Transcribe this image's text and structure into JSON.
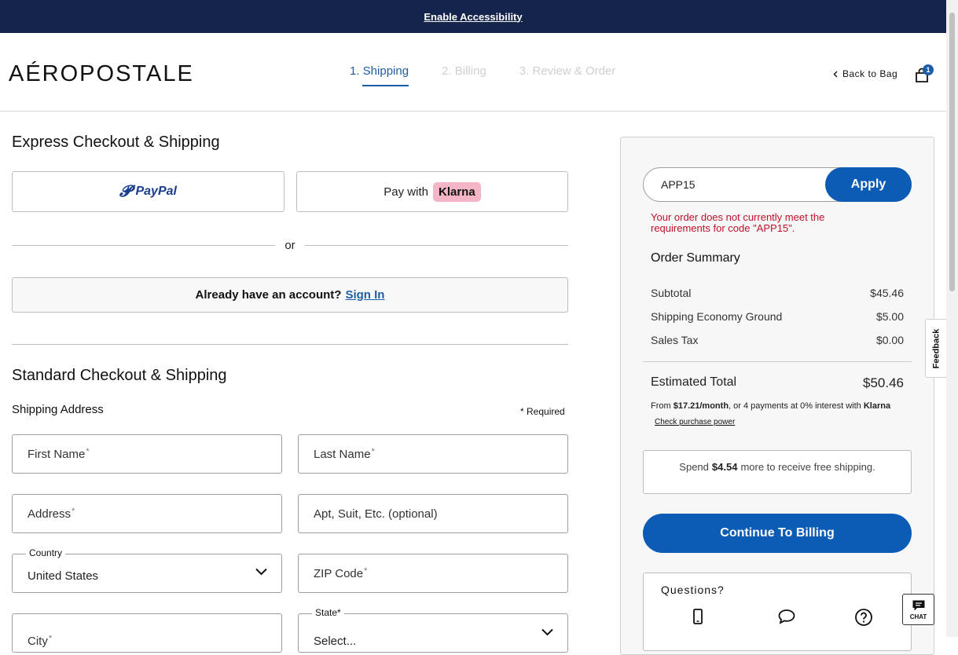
{
  "topbar": {
    "accessibility_link": "Enable Accessibility"
  },
  "header": {
    "logo": "AÉROPOSTALE",
    "steps": [
      {
        "label": "1. Shipping",
        "active": true
      },
      {
        "label": "2. Billing",
        "active": false
      },
      {
        "label": "3. Review & Order",
        "active": false
      }
    ],
    "back_to_bag": "Back to Bag",
    "bag_count": "1"
  },
  "express": {
    "title": "Express Checkout & Shipping",
    "paypal_label": "PayPal",
    "paywith_label": "Pay with",
    "klarna_label": "Klarna",
    "or_label": "or",
    "account_prompt": "Already have an account?",
    "sign_in": "Sign In"
  },
  "standard": {
    "title": "Standard Checkout & Shipping",
    "address_heading": "Shipping Address",
    "required_note": "* Required",
    "fields": {
      "first_name": "First Name",
      "last_name": "Last Name",
      "address": "Address",
      "apt": "Apt, Suit, Etc. (optional)",
      "country_label": "Country",
      "country_value": "United States",
      "zip": "ZIP Code",
      "city": "City",
      "state_label": "State",
      "state_value": "Select..."
    },
    "star": "*"
  },
  "summary": {
    "promo_value": "APP15",
    "apply_label": "Apply",
    "promo_error": "Your order does not currently meet the requirements for code \"APP15\".",
    "title": "Order Summary",
    "rows": [
      {
        "label": "Subtotal",
        "value": "$45.46"
      },
      {
        "label": "Shipping Economy Ground",
        "value": "$5.00"
      },
      {
        "label": "Sales Tax",
        "value": "$0.00"
      }
    ],
    "estimated_label": "Estimated Total",
    "estimated_value": "$50.46",
    "klarna_prefix": "From",
    "klarna_amount": "$17.21/month",
    "klarna_suffix": ", or 4 payments at 0% interest with",
    "klarna_brand": "Klarna",
    "check_power": "Check purchase power",
    "free_ship_prefix": "Spend",
    "free_ship_amount": "$4.54",
    "free_ship_suffix": "more to receive free shipping.",
    "continue_label": "Continue To Billing",
    "questions_title": "Questions?"
  },
  "feedback_label": "Feedback",
  "chat_label": "CHAT",
  "colors": {
    "nav": "#15244a",
    "accent": "#0c5bb5",
    "error": "#c0102a",
    "klarna": "#f4b6c7"
  },
  "icons": [
    "chevron-left-icon",
    "bag-icon",
    "chevron-down-icon",
    "phone-icon",
    "chat-bubble-icon",
    "help-icon",
    "chat-icon"
  ]
}
